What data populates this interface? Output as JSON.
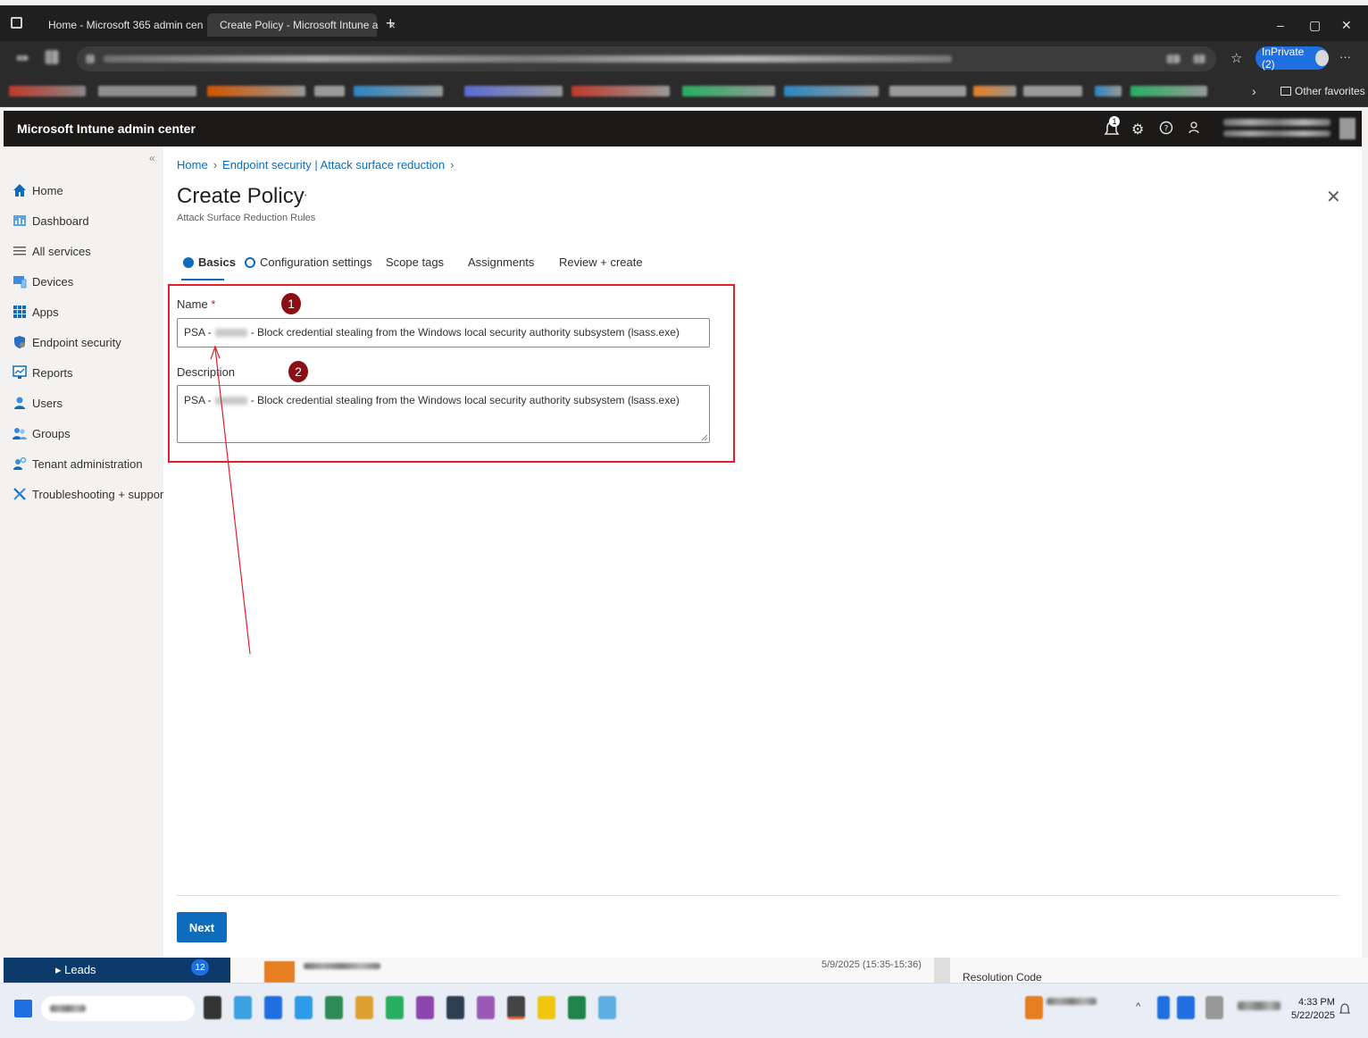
{
  "browser": {
    "tabs": [
      {
        "title": "Home - Microsoft 365 admin cen",
        "close": "×"
      },
      {
        "title": "Create Policy - Microsoft Intune a",
        "close": "×"
      }
    ],
    "new_tab": "+",
    "window_controls": {
      "minimize": "–",
      "restore": "▢",
      "close": "✕"
    },
    "inprivate_label": "InPrivate (2)",
    "more_menu": "···",
    "other_favorites": "Other favorites"
  },
  "app": {
    "title": "Microsoft Intune admin center",
    "notification_count": "1"
  },
  "sidebar": {
    "collapse": "«",
    "items": [
      {
        "label": "Home",
        "icon": "home-icon"
      },
      {
        "label": "Dashboard",
        "icon": "dashboard-icon"
      },
      {
        "label": "All services",
        "icon": "list-icon"
      },
      {
        "label": "Devices",
        "icon": "devices-icon"
      },
      {
        "label": "Apps",
        "icon": "apps-grid-icon"
      },
      {
        "label": "Endpoint security",
        "icon": "shield-icon"
      },
      {
        "label": "Reports",
        "icon": "reports-icon"
      },
      {
        "label": "Users",
        "icon": "user-icon"
      },
      {
        "label": "Groups",
        "icon": "groups-icon"
      },
      {
        "label": "Tenant administration",
        "icon": "tenant-admin-icon"
      },
      {
        "label": "Troubleshooting + support",
        "icon": "wrench-icon"
      }
    ]
  },
  "breadcrumb": {
    "home": "Home",
    "section": "Endpoint security | Attack surface reduction",
    "sep": "›"
  },
  "page": {
    "title": "Create Policy",
    "more": "···",
    "subtitle": "Attack Surface Reduction Rules",
    "close": "✕"
  },
  "wizard": {
    "tabs": [
      "Basics",
      "Configuration settings",
      "Scope tags",
      "Assignments",
      "Review + create"
    ]
  },
  "form": {
    "name_label": "Name",
    "required_mark": "*",
    "name_prefix": "PSA -",
    "name_value": "- Block credential stealing from the Windows local security authority subsystem (lsass.exe)",
    "description_label": "Description",
    "description_prefix": "PSA -",
    "description_value": "- Block credential stealing from the Windows local security authority subsystem (lsass.exe)"
  },
  "annotations": {
    "badge1": "1",
    "badge2": "2",
    "box_color": "#e0202a"
  },
  "footer": {
    "next_label": "Next"
  },
  "background": {
    "leads_label": "▸ Leads",
    "leads_count": "12",
    "date_range": "5/9/2025 (15:35-15:36)",
    "resolution_label": "Resolution Code"
  },
  "taskbar": {
    "time": "4:33 PM",
    "date": "5/22/2025"
  },
  "colors": {
    "accent": "#0f6cbd",
    "header_bg": "#1b1a19",
    "badge": "#8b0f14"
  }
}
